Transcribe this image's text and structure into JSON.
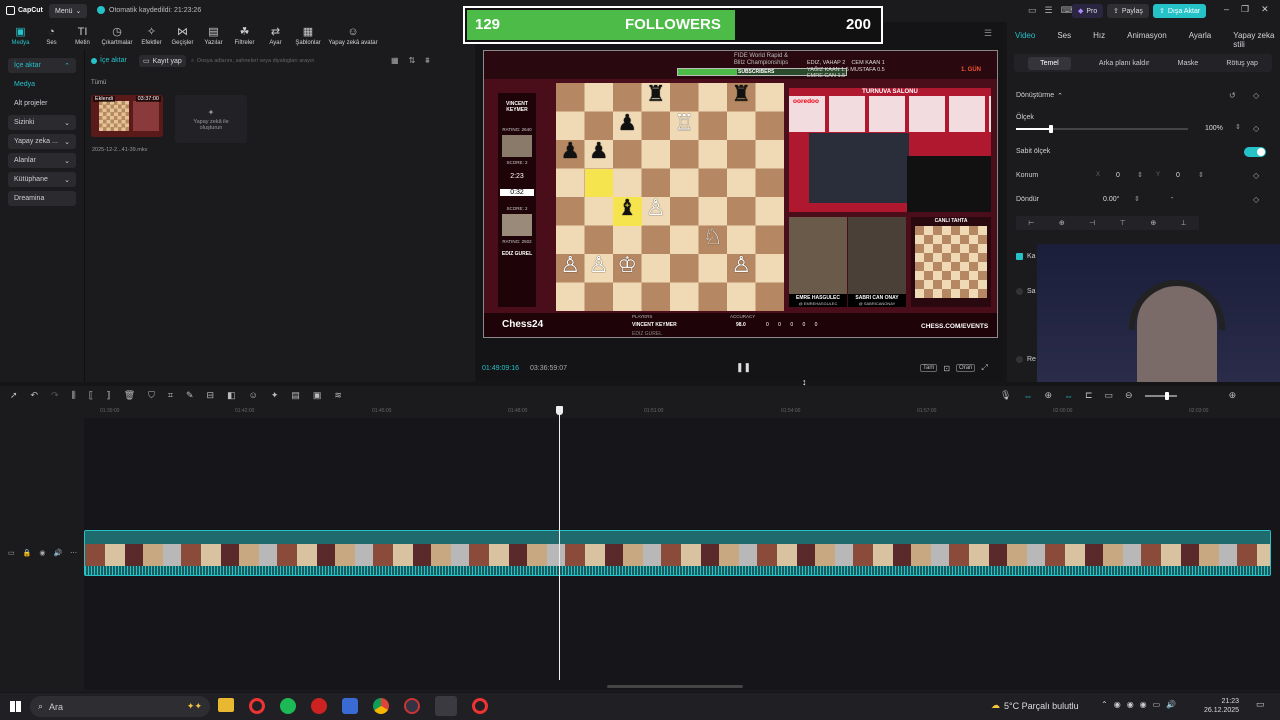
{
  "app": {
    "name": "CapCut",
    "menu_label": "Menü",
    "autosave": "Otomatik kaydedildi: 21:23:26",
    "pro_label": "Pro",
    "share_label": "Paylaş",
    "export_label": "Dışa Aktar"
  },
  "toolbar": {
    "items": [
      {
        "label": "Medya",
        "icon": "media-icon"
      },
      {
        "label": "Ses",
        "icon": "audio-icon"
      },
      {
        "label": "Metin",
        "icon": "text-icon"
      },
      {
        "label": "Çıkartmalar",
        "icon": "sticker-icon"
      },
      {
        "label": "Efektler",
        "icon": "effects-icon"
      },
      {
        "label": "Geçişler",
        "icon": "transitions-icon"
      },
      {
        "label": "Yazılar",
        "icon": "captions-icon"
      },
      {
        "label": "Filtreler",
        "icon": "filters-icon"
      },
      {
        "label": "Ayar",
        "icon": "adjust-icon"
      },
      {
        "label": "Şablonlar",
        "icon": "templates-icon"
      },
      {
        "label": "Yapay zekâ avatar",
        "icon": "ai-avatar-icon"
      }
    ]
  },
  "sidebar": {
    "items": [
      {
        "label": "İçe aktar"
      },
      {
        "label": "Medya"
      },
      {
        "label": "Alt projeler"
      },
      {
        "label": "Sizinki"
      },
      {
        "label": "Yapay zeka ..."
      },
      {
        "label": "Alanlar"
      },
      {
        "label": "Kütüphane"
      },
      {
        "label": "Dreamina"
      }
    ]
  },
  "media": {
    "import_label": "İçe aktar",
    "record_label": "Kayıt yap",
    "search_placeholder": "Dosya adlarını, sahneleri veya diyalogları arayın",
    "filter_all": "Tümü",
    "clip": {
      "badge": "Eklendi",
      "duration": "03:37:00",
      "name": "2025-12-2...41-39.mkv"
    },
    "ai_create": "Yapay zekâ ile oluşturun"
  },
  "preview": {
    "current_time": "01:49:09:16",
    "total_time": "03:36:59:07",
    "btn_full": "Tam",
    "btn_ratio": "Oran"
  },
  "overlay": {
    "followers_current": "129",
    "followers_label": "FOLLOWERS",
    "followers_goal": "200",
    "subscribers_label": "SUBSCRIBERS"
  },
  "stream": {
    "event_line1": "FIDE World Rapid &",
    "event_line2": "Blitz Championships",
    "tournament_hall": "TURNUVA SALONU",
    "live_board": "CANLI TAHTA",
    "player_top": "VINCENT KEYMER",
    "rating_top": "RATING: 2640",
    "score_top": "SCORE: 2",
    "clock_top": "2:23",
    "clock_bottom": "0:32",
    "score_bottom": "SCORE: 2",
    "rating_bottom": "RATING: 2502",
    "player_bottom": "EDIZ GUREL",
    "cam_left": "EMRE HASGULEC",
    "cam_left_handle": "@ EMREHASGULEC",
    "cam_right": "SABRI CAN ONAY",
    "cam_right_handle": "@ SABRICANONAY",
    "brand": "Chess24",
    "website": "CHESS.COM/EVENTS",
    "day": "1. GÜN",
    "players_hdr": "PLAYERS",
    "accuracy_hdr": "ACCURACY",
    "acc_name": "VINCENT KEYMER",
    "acc_value": "98.0",
    "acc_zeros": "0 0 0 0 0",
    "acc_name2": "EDIZ GUREL",
    "match1": "EDIZ, VAHAP 2",
    "match2": "CEM KAAN 1",
    "match3": "YAĞIZ KAAN 1.5 MUSTAFA 0.5",
    "match4": "EMRE CAN 1.5",
    "sponsor": "ooredoo"
  },
  "right_panel": {
    "tabs": [
      "Video",
      "Ses",
      "Hız",
      "Animasyon",
      "Ayarla",
      "Yapay zeka stili"
    ],
    "subtabs": [
      "Temel",
      "Arka planı kaldır",
      "Maske",
      "Rötuş yap"
    ],
    "transform_label": "Dönüştürme",
    "scale_label": "Ölçek",
    "scale_value": "100%",
    "uniform_scale": "Sabit ölçek",
    "position_label": "Konum",
    "pos_x_label": "X",
    "pos_x": "0",
    "pos_y_label": "Y",
    "pos_y": "0",
    "rotate_label": "Döndür",
    "rotate_value": "0.00°",
    "rotate_dash": "-",
    "checkbox1": "Ka",
    "checkbox2": "Sa",
    "checkbox3": "Re"
  },
  "timeline": {
    "ruler": [
      "01:39:00",
      "01:42:00",
      "01:45:00",
      "01:48:00",
      "01:51:00",
      "01:54:00",
      "01:57:00",
      "02:00:00",
      "02:03:00"
    ]
  },
  "taskbar": {
    "search_placeholder": "Ara",
    "weather": "5°C Parçalı bulutlu",
    "time": "21:23",
    "date": "26.12.2025"
  },
  "colors": {
    "accent": "#25c2c8",
    "followers_green": "#4cbb47"
  }
}
